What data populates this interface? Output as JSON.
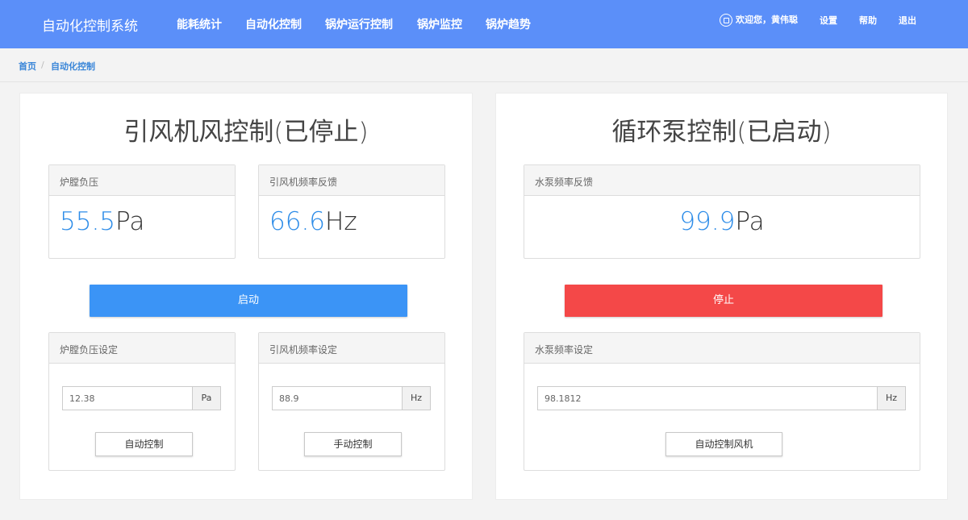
{
  "header": {
    "brand": "自动化控制系统",
    "nav": [
      "能耗统计",
      "自动化控制",
      "锅炉运行控制",
      "锅炉监控",
      "锅炉趋势"
    ],
    "welcome": "欢迎您，黄伟聪",
    "settings": "设置",
    "help": "帮助",
    "logout": "退出"
  },
  "breadcrumb": {
    "home": "首页",
    "separator": "/",
    "current": "自动化控制"
  },
  "fan_panel": {
    "title": "引风机风控制(已停止)",
    "pressure": {
      "label": "炉膛负压",
      "value": "55.5",
      "unit": "Pa"
    },
    "frequency": {
      "label": "引风机频率反馈",
      "value": "66.6",
      "unit": "Hz"
    },
    "action_button": "启动",
    "pressure_setting": {
      "label": "炉膛负压设定",
      "value": "12.38",
      "unit": "Pa",
      "button": "自动控制"
    },
    "frequency_setting": {
      "label": "引风机频率设定",
      "value": "88.9",
      "unit": "Hz",
      "button": "手动控制"
    }
  },
  "pump_panel": {
    "title": "循环泵控制(已启动)",
    "frequency": {
      "label": "水泵频率反馈",
      "value": "99.9",
      "unit": "Pa"
    },
    "action_button": "停止",
    "frequency_setting": {
      "label": "水泵频率设定",
      "value": "98.1812",
      "unit": "Hz",
      "button": "自动控制风机"
    }
  },
  "colors": {
    "header": "#5b8ff9",
    "start_button": "#3b94f6",
    "stop_button": "#f44848",
    "reading_number": "#2d8ce8"
  }
}
